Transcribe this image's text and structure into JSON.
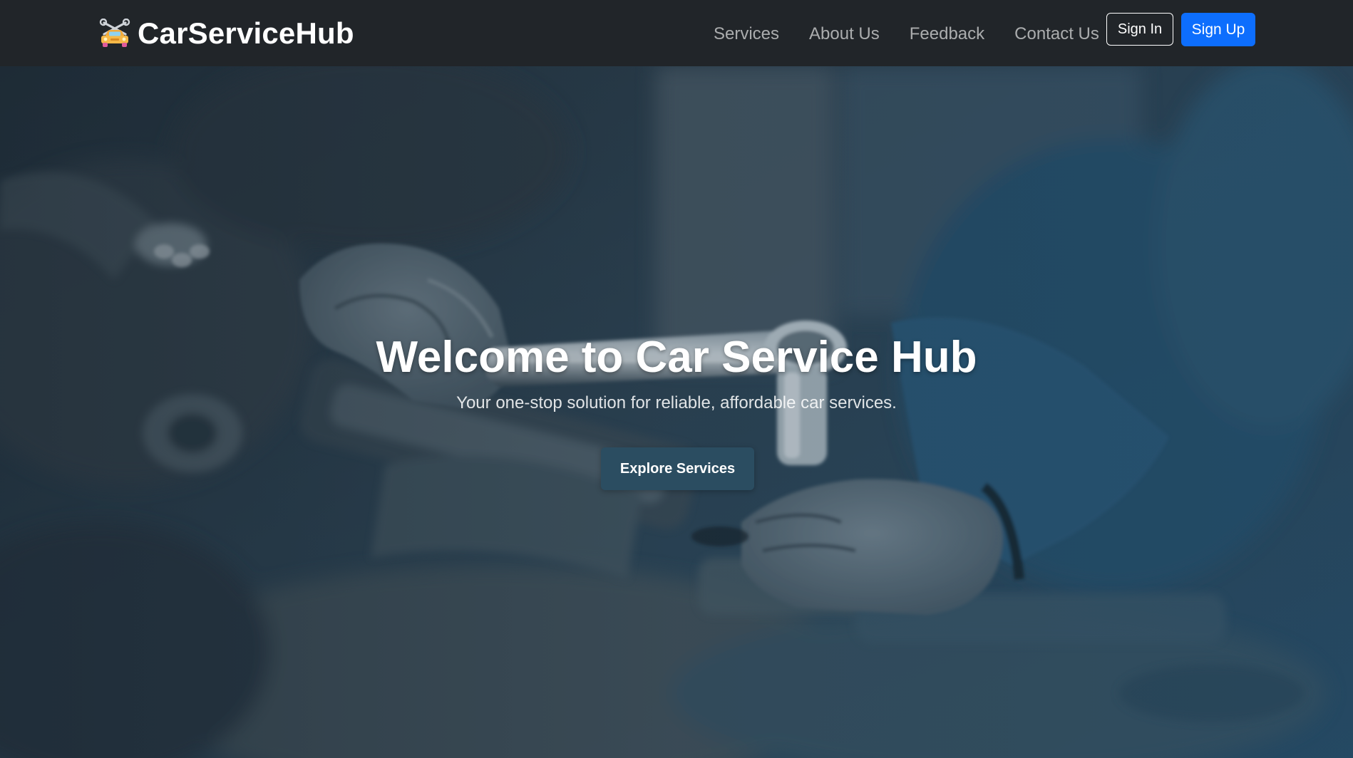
{
  "navbar": {
    "brand_text": "CarServiceHub",
    "brand_icon": "car-wrench-icon",
    "links": [
      {
        "label": "Services"
      },
      {
        "label": "About Us"
      },
      {
        "label": "Feedback"
      },
      {
        "label": "Contact Us"
      }
    ],
    "sign_in_label": "Sign In",
    "sign_up_label": "Sign Up"
  },
  "hero": {
    "title": "Welcome to Car Service Hub",
    "subtitle": "Your one-stop solution for reliable, affordable car services.",
    "cta_label": "Explore Services",
    "background_image": "mechanic-hands-with-ratchet-over-engine"
  },
  "colors": {
    "navbar_bg": "#212529",
    "nav_link": "#9b9fa3",
    "sign_up_bg": "#0d6efd",
    "cta_bg": "#2b4d61",
    "hero_tint": "#2a4a5e"
  }
}
